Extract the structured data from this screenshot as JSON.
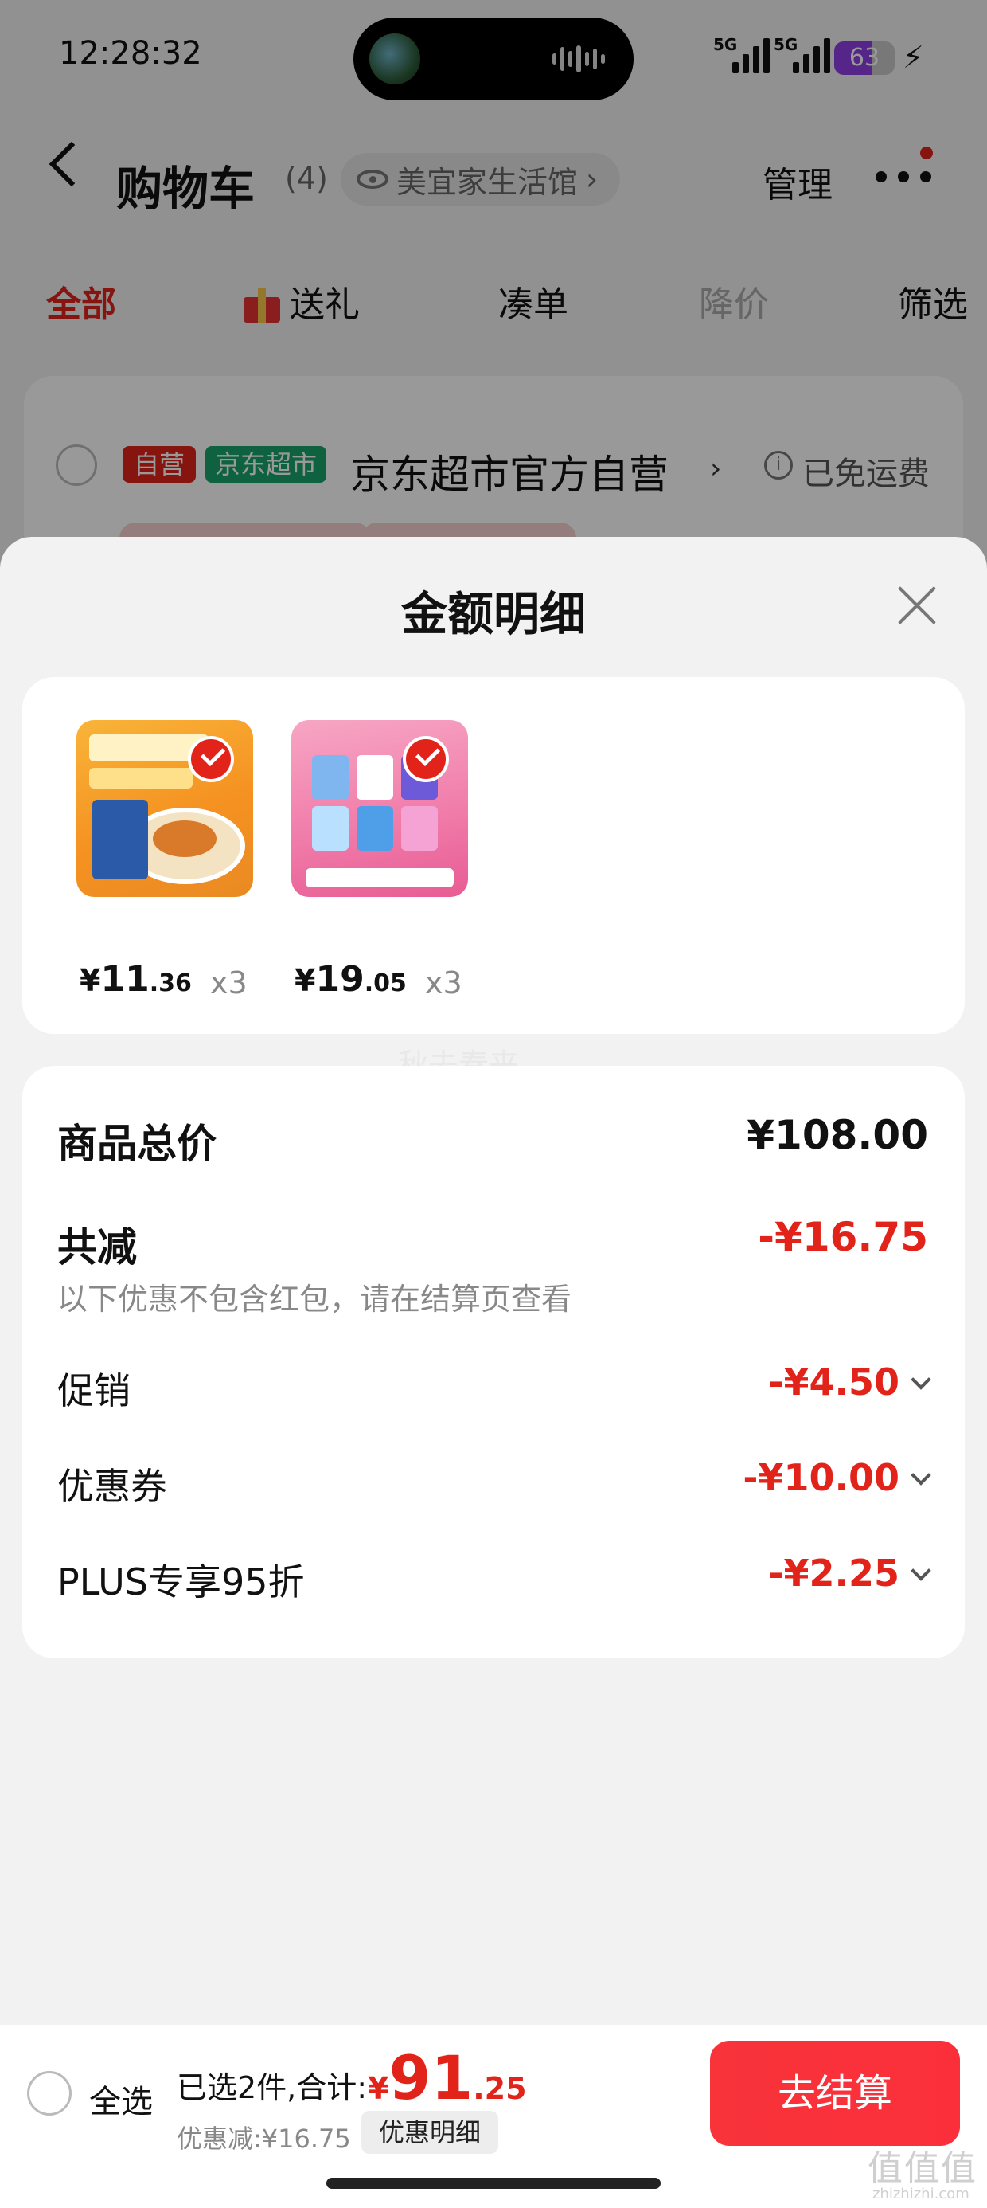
{
  "status_bar": {
    "time": "12:28:32",
    "sim1": "5G",
    "sim2": "5G",
    "battery": "63",
    "battery_level": 0.63
  },
  "nav": {
    "title": "购物车",
    "count": "(4)",
    "store_pill": "美宜家生活馆",
    "store_chevron": "›",
    "manage": "管理"
  },
  "tabs": [
    {
      "label": "全部",
      "state": "active"
    },
    {
      "label": "送礼",
      "icon": "gift-icon"
    },
    {
      "label": "凑单"
    },
    {
      "label": "降价",
      "state": "disabled"
    },
    {
      "label": "筛选"
    }
  ],
  "shop": {
    "tag_self": "自营",
    "tag_market": "京东超市",
    "name": "京东超市官方自营",
    "chevron": "›",
    "info_icon": "i",
    "shipping": "已免运费"
  },
  "sheet": {
    "title": "金额明细",
    "watermark": "秋去春来",
    "products": [
      {
        "image": "food-product-image",
        "price_currency": "¥",
        "price_int": "11",
        "price_dec": ".36",
        "qty": "x3"
      },
      {
        "image": "pad-product-image",
        "price_currency": "¥",
        "price_int": "19",
        "price_dec": ".05",
        "qty": "x3"
      }
    ],
    "summary": {
      "total_label": "商品总价",
      "total_value": "¥108.00",
      "reduce_label": "共减",
      "reduce_value": "-¥16.75",
      "note": "以下优惠不包含红包，请在结算页查看",
      "items": [
        {
          "label": "促销",
          "value": "-¥4.50"
        },
        {
          "label": "优惠券",
          "value": "-¥10.00"
        },
        {
          "label": "PLUS专享95折",
          "value": "-¥2.25"
        }
      ]
    }
  },
  "bottom_bar": {
    "select_all": "全选",
    "selected_text": "已选2件,合计:",
    "total_currency": "¥",
    "total_int": "91",
    "total_dec": ".25",
    "discount_text": "优惠减:¥16.75",
    "detail_button": "优惠明细",
    "checkout_button": "去结算"
  },
  "colors": {
    "accent": "#e2231a",
    "market_green": "#1aa36b",
    "battery_purple": "#8e3fe6"
  },
  "corner_watermark": {
    "logo": "值值值",
    "site": "zhizhizhi.com"
  }
}
